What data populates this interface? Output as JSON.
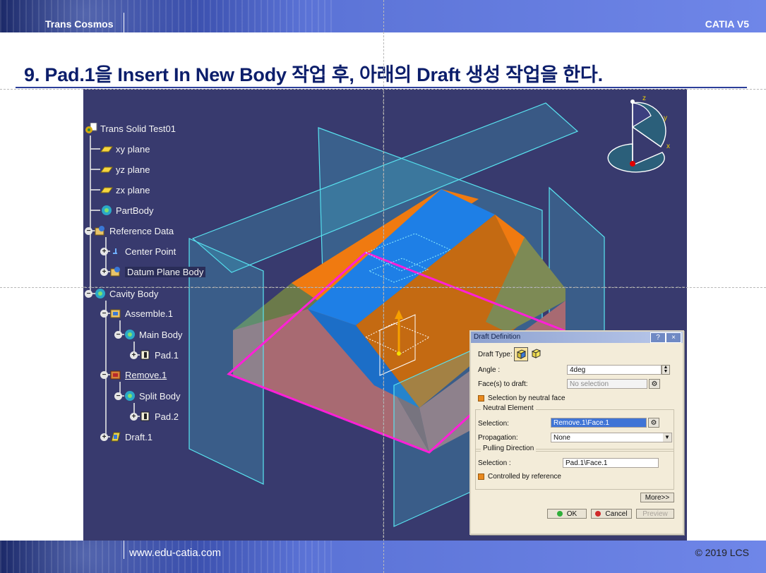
{
  "header": {
    "brand": "Trans Cosmos",
    "product": "CATIA V5"
  },
  "slide": {
    "title": "9. Pad.1을 Insert In New Body 작업 후, 아래의 Draft 생성 작업을 한다."
  },
  "footer": {
    "url": "www.edu-catia.com",
    "copyright": "© 2019 LCS"
  },
  "tree": {
    "root": "Trans Solid Test01",
    "items": [
      {
        "label": "xy plane",
        "icon": "plane-icon"
      },
      {
        "label": "yz plane",
        "icon": "plane-icon"
      },
      {
        "label": "zx plane",
        "icon": "plane-icon"
      },
      {
        "label": "PartBody",
        "icon": "body-gear-icon"
      },
      {
        "label": "Reference Data",
        "icon": "geometrical-set-icon"
      },
      {
        "label": "Center Point",
        "icon": "point-icon"
      },
      {
        "label": "Datum Plane Body",
        "icon": "geometrical-set-icon"
      },
      {
        "label": "Cavity Body",
        "icon": "body-gear-icon"
      },
      {
        "label": "Assemble.1",
        "icon": "assemble-icon"
      },
      {
        "label": "Main Body",
        "icon": "body-gear-icon"
      },
      {
        "label": "Pad.1",
        "icon": "pad-icon"
      },
      {
        "label": "Remove.1",
        "icon": "remove-icon"
      },
      {
        "label": "Split Body",
        "icon": "body-gear-icon"
      },
      {
        "label": "Pad.2",
        "icon": "pad-icon"
      },
      {
        "label": "Draft.1",
        "icon": "draft-icon"
      }
    ]
  },
  "compass": {
    "x": "x",
    "y": "y",
    "z": "z"
  },
  "dialog": {
    "title": "Draft Definition",
    "help_btn": "?",
    "close_btn": "×",
    "draft_type_label": "Draft Type:",
    "angle_label": "Angle :",
    "angle_value": "4deg",
    "faces_label": "Face(s) to draft:",
    "faces_value": "No selection",
    "neutral_face_option": "Selection by neutral face",
    "neutral_group": "Neutral Element",
    "neutral_selection_label": "Selection:",
    "neutral_selection_value": "Remove.1\\Face.1",
    "propagation_label": "Propagation:",
    "propagation_value": "None",
    "pulling_group": "Pulling Direction",
    "pulling_selection_label": "Selection :",
    "pulling_selection_value": "Pad.1\\Face.1",
    "controlled_option": "Controlled by reference",
    "more_btn": "More>>",
    "ok_btn": "OK",
    "cancel_btn": "Cancel",
    "preview_btn": "Preview"
  },
  "colors": {
    "viewport_bg": "#383a6e",
    "face_orange": "#f07a10",
    "face_blue": "#1e7fe6",
    "plane_cyan": "#3fc7dc",
    "edge_magenta": "#ff1fd8",
    "title_navy": "#0c1e6b"
  }
}
